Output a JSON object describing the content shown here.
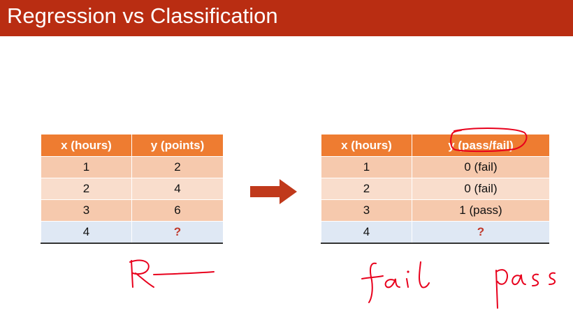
{
  "slide": {
    "title": "Regression vs Classification",
    "colors": {
      "title_bar": "#b92d12",
      "header": "#ee7c31",
      "row_dark": "#f6c9ad",
      "row_light": "#f9ddcc",
      "query_row": "#dfe8f4",
      "question_mark": "#c0392b",
      "arrow": "#c0391b",
      "ink": "#e8001c"
    }
  },
  "regression_table": {
    "headers": [
      "x (hours)",
      "y (points)"
    ],
    "rows": [
      [
        "1",
        "2"
      ],
      [
        "2",
        "4"
      ],
      [
        "3",
        "6"
      ],
      [
        "4",
        "?"
      ]
    ]
  },
  "classification_table": {
    "headers": [
      "x (hours)",
      "y (pass/fail)"
    ],
    "rows": [
      [
        "1",
        "0 (fail)"
      ],
      [
        "2",
        "0 (fail)"
      ],
      [
        "3",
        "1 (pass)"
      ],
      [
        "4",
        "?"
      ]
    ]
  },
  "annotations": {
    "handwriting": [
      "R",
      "fail",
      "pass"
    ],
    "icons": [
      "right-arrow-icon",
      "circle-highlight-icon"
    ]
  }
}
